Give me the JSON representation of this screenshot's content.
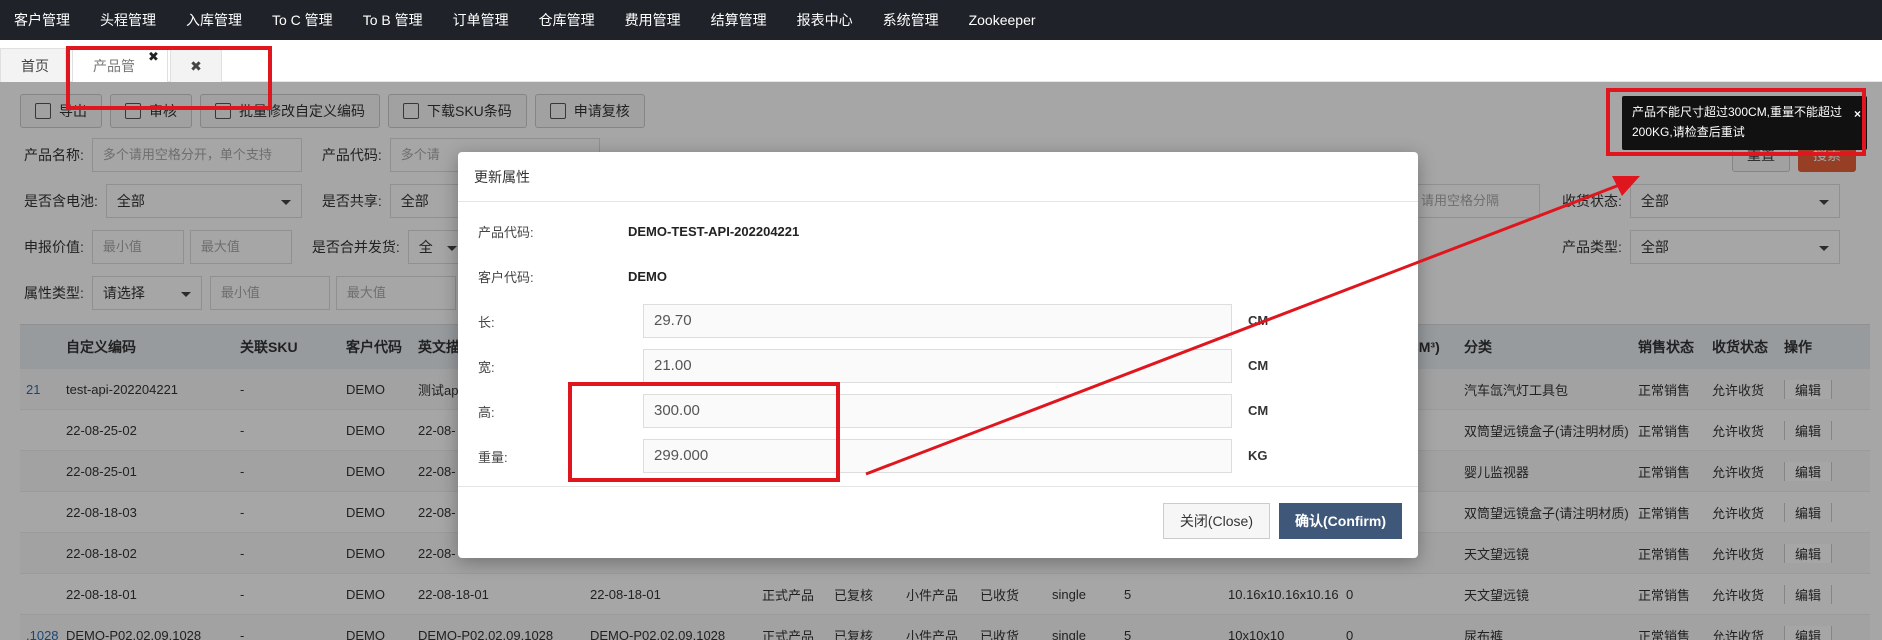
{
  "nav": {
    "items": [
      "客户管理",
      "头程管理",
      "入库管理",
      "To C 管理",
      "To B 管理",
      "订单管理",
      "仓库管理",
      "费用管理",
      "结算管理",
      "报表中心",
      "系统管理",
      "Zookeeper"
    ]
  },
  "tabs": {
    "home": "首页",
    "product": "产品管理",
    "close_all": "✖",
    "close_x": "✖"
  },
  "toolbar": {
    "export": "导出",
    "review": "审核",
    "batch_edit": "批量修改自定义编码",
    "download_sku": "下载SKU条码",
    "apply_review": "申请复核"
  },
  "filters": {
    "product_name_label": "产品名称:",
    "product_name_placeholder": "多个请用空格分开，单个支持",
    "product_code_label": "产品代码:",
    "product_code_placeholder": "多个请",
    "battery_label": "是否含电池:",
    "battery_value": "全部",
    "shared_label": "是否共享:",
    "shared_value": "全部",
    "declare_label": "申报价值:",
    "min_placeholder": "最小值",
    "max_placeholder": "最大值",
    "merge_label": "是否合并发货:",
    "merge_value": "全",
    "attr_label": "属性类型:",
    "attr_value": "请选择",
    "receive_status_label": "收货状态:",
    "receive_status_value": "全部",
    "product_type_label": "产品类型:",
    "product_type_value": "全部",
    "space_hint": "请用空格分隔",
    "reset": "重置",
    "search": "搜索"
  },
  "table": {
    "headers": [
      "自定义编码",
      "关联SKU",
      "客户代码",
      "英文描",
      "分类",
      "销售状态",
      "收货状态",
      "操作"
    ],
    "volume_header": "积(CM³)",
    "edit_label": "编辑",
    "rows": [
      {
        "lead": "21",
        "code": "test-api-202204221",
        "sku": "-",
        "customer": "DEMO",
        "en": "测试api",
        "category": "汽车氙汽灯工具包",
        "sale": "正常销售",
        "receive": "允许收货"
      },
      {
        "lead": "",
        "code": "22-08-25-02",
        "sku": "-",
        "customer": "DEMO",
        "en": "22-08-",
        "category": "双筒望远镜盒子(请注明材质)",
        "sale": "正常销售",
        "receive": "允许收货"
      },
      {
        "lead": "",
        "code": "22-08-25-01",
        "sku": "-",
        "customer": "DEMO",
        "en": "22-08-",
        "category": "婴儿监视器",
        "sale": "正常销售",
        "receive": "允许收货"
      },
      {
        "lead": "",
        "code": "22-08-18-03",
        "sku": "-",
        "customer": "DEMO",
        "en": "22-08-",
        "category": "双筒望远镜盒子(请注明材质)",
        "sale": "正常销售",
        "receive": "允许收货"
      },
      {
        "lead": "",
        "code": "22-08-18-02",
        "sku": "-",
        "customer": "DEMO",
        "en": "22-08-",
        "category": "天文望远镜",
        "sale": "正常销售",
        "receive": "允许收货"
      },
      {
        "lead": "",
        "code": "22-08-18-01",
        "sku": "-",
        "customer": "DEMO",
        "en": "22-08-18-01",
        "en2": "22-08-18-01",
        "type": "正式产品",
        "review": "已复核",
        "size": "小件产品",
        "recv": "已收货",
        "pack": "single",
        "qty": "5",
        "dims": "10.16x10.16x10.16",
        "vol": "0",
        "category": "天文望远镜",
        "sale": "正常销售",
        "receive": "允许收货"
      },
      {
        "lead": ".1028",
        "code": "DEMO-P02.02.09.1028",
        "sku": "-",
        "customer": "DEMO",
        "en": "DEMO-P02.02.09.1028",
        "en2": "DEMO-P02.02.09.1028",
        "type": "正式产品",
        "review": "已复核",
        "size": "小件产品",
        "recv": "已收货",
        "pack": "single",
        "qty": "5",
        "dims": "10x10x10",
        "vol": "0",
        "category": "尿布裤",
        "sale": "正常销售",
        "receive": "允许收货"
      }
    ]
  },
  "modal": {
    "title": "更新属性",
    "product_code_label": "产品代码:",
    "product_code_value": "DEMO-TEST-API-202204221",
    "customer_code_label": "客户代码:",
    "customer_code_value": "DEMO",
    "length_label": "长:",
    "length_value": "29.70",
    "width_label": "宽:",
    "width_value": "21.00",
    "height_label": "高:",
    "height_value": "300.00",
    "weight_label": "重量:",
    "weight_value": "299.000",
    "unit_cm": "CM",
    "unit_kg": "KG",
    "close_button": "关闭(Close)",
    "confirm_button": "确认(Confirm)"
  },
  "toast": {
    "message": "产品不能尺寸超过300CM,重量不能超过200KG,请检查后重试",
    "close": "×"
  },
  "colors": {
    "nav_bg": "#1f2329",
    "confirm_bg": "#3f587a",
    "annotation_red": "#e0161e"
  }
}
